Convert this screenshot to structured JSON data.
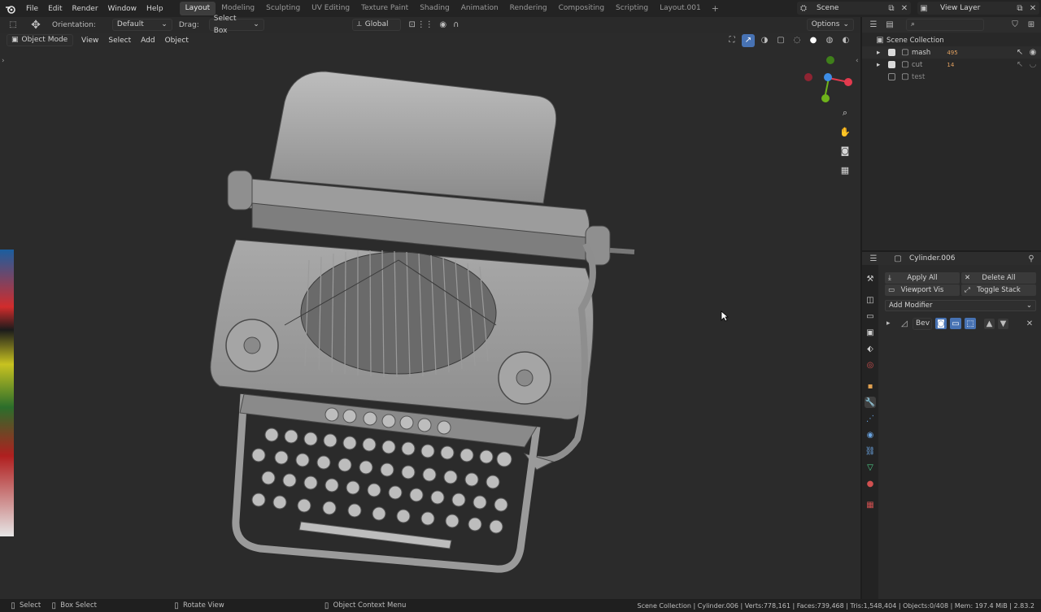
{
  "menu": {
    "file": "File",
    "edit": "Edit",
    "render": "Render",
    "window": "Window",
    "help": "Help"
  },
  "workspaces": [
    "Layout",
    "Modeling",
    "Sculpting",
    "UV Editing",
    "Texture Paint",
    "Shading",
    "Animation",
    "Rendering",
    "Compositing",
    "Scripting",
    "Layout.001"
  ],
  "active_workspace": "Layout",
  "scene": {
    "name": "Scene",
    "view_layer": "View Layer"
  },
  "toolbar": {
    "orientation_label": "Orientation:",
    "orientation_value": "Default",
    "drag_label": "Drag:",
    "drag_value": "Select Box",
    "transform_orientation": "Global",
    "options": "Options"
  },
  "viewport_header": {
    "mode": "Object Mode",
    "view": "View",
    "select": "Select",
    "add": "Add",
    "object": "Object"
  },
  "outliner": {
    "root": "Scene Collection",
    "items": [
      {
        "name": "mash",
        "extra": "495"
      },
      {
        "name": "cut",
        "extra": "14"
      },
      {
        "name": "test",
        "extra": ""
      }
    ]
  },
  "properties": {
    "object_name": "Cylinder.006",
    "apply_all": "Apply All",
    "delete_all": "Delete All",
    "viewport_vis": "Viewport Vis",
    "toggle_stack": "Toggle Stack",
    "add_modifier": "Add Modifier",
    "modifier_name": "Bev"
  },
  "status": {
    "select": "Select",
    "box_select": "Box Select",
    "rotate_view": "Rotate View",
    "context_menu": "Object Context Menu",
    "stats": "Scene Collection | Cylinder.006 | Verts:778,161 | Faces:739,468 | Tris:1,548,404 | Objects:0/408 | Mem: 197.4 MiB | 2.83.2"
  },
  "colors": {
    "accent": "#4772b3",
    "active_tab": "#3d3d3d",
    "axis_x": "#e33a4e",
    "axis_y": "#6fb31b",
    "axis_z": "#3d8de6"
  },
  "icons": {
    "logo": "blender-logo-icon",
    "gizmo_zoom": "zoom-icon",
    "gizmo_pan": "hand-icon",
    "gizmo_camera": "camera-icon",
    "gizmo_ortho": "grid-icon"
  }
}
